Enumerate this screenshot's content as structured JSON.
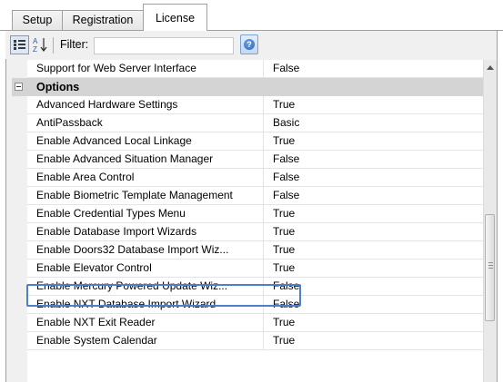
{
  "tabs": [
    {
      "label": "Setup"
    },
    {
      "label": "Registration"
    },
    {
      "label": "License",
      "active": true
    }
  ],
  "toolbar": {
    "categorized_icon": "categorized-view-icon",
    "alphabetical_icon": "sort-az-icon",
    "filter_label": "Filter:",
    "filter_value": "",
    "help_icon": "help-icon"
  },
  "properties": {
    "pre_category": {
      "name": "Support for Web Server Interface",
      "value": "False"
    },
    "category": {
      "label": "Options",
      "expanded": true
    },
    "rows": [
      {
        "name": "Advanced Hardware Settings",
        "value": "True"
      },
      {
        "name": "AntiPassback",
        "value": "Basic"
      },
      {
        "name": "Enable Advanced Local Linkage",
        "value": "True"
      },
      {
        "name": "Enable Advanced Situation Manager",
        "value": "False"
      },
      {
        "name": "Enable Area Control",
        "value": "False"
      },
      {
        "name": "Enable Biometric Template Management",
        "value": "False"
      },
      {
        "name": "Enable Credential Types Menu",
        "value": "True"
      },
      {
        "name": "Enable Database Import Wizards",
        "value": "True"
      },
      {
        "name": "Enable Doors32 Database Import Wiz...",
        "value": "True"
      },
      {
        "name": "Enable Elevator Control",
        "value": "True",
        "highlighted": true
      },
      {
        "name": "Enable Mercury Powered Update Wiz...",
        "value": "False"
      },
      {
        "name": "Enable NXT Database Import Wizard",
        "value": "False"
      },
      {
        "name": "Enable NXT Exit Reader",
        "value": "True"
      },
      {
        "name": "Enable System Calendar",
        "value": "True"
      }
    ]
  },
  "colors": {
    "highlight_border": "#4f7ecb",
    "category_bg": "#d4d4d4",
    "panel_bg": "#f0f0f0"
  }
}
